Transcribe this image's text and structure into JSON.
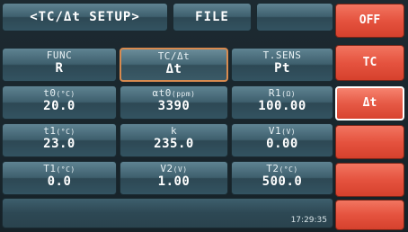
{
  "header": {
    "title": "<TC/Δt SETUP>",
    "file_label": "FILE",
    "blank_label": ""
  },
  "rows": [
    [
      {
        "label": "FUNC",
        "unit": "",
        "value": "R"
      },
      {
        "label": "TC/Δt",
        "unit": "",
        "value": "Δt"
      },
      {
        "label": "T.SENS",
        "unit": "",
        "value": "Pt"
      }
    ],
    [
      {
        "label": "t0",
        "unit": "(°C)",
        "value": "20.0"
      },
      {
        "label": "αt0",
        "unit": "(ppm)",
        "value": "3390"
      },
      {
        "label": "R1",
        "unit": "(Ω)",
        "value": "100.00"
      }
    ],
    [
      {
        "label": "t1",
        "unit": "(°C)",
        "value": "23.0"
      },
      {
        "label": "k",
        "unit": "",
        "value": "235.0"
      },
      {
        "label": "V1",
        "unit": "(V)",
        "value": "0.00"
      }
    ],
    [
      {
        "label": "T1",
        "unit": "(°C)",
        "value": "0.0"
      },
      {
        "label": "V2",
        "unit": "(V)",
        "value": "1.00"
      },
      {
        "label": "T2",
        "unit": "(°C)",
        "value": "500.0"
      }
    ]
  ],
  "sidebar": {
    "items": [
      {
        "label": "OFF"
      },
      {
        "label": "TC"
      },
      {
        "label": "Δt"
      },
      {
        "label": ""
      },
      {
        "label": ""
      },
      {
        "label": ""
      }
    ]
  },
  "status": {
    "time": "17:29:35"
  },
  "colors": {
    "cell": "#3e5f6d",
    "selected_border": "#d88a4f",
    "side_button": "#e5533f",
    "background": "#162228"
  }
}
